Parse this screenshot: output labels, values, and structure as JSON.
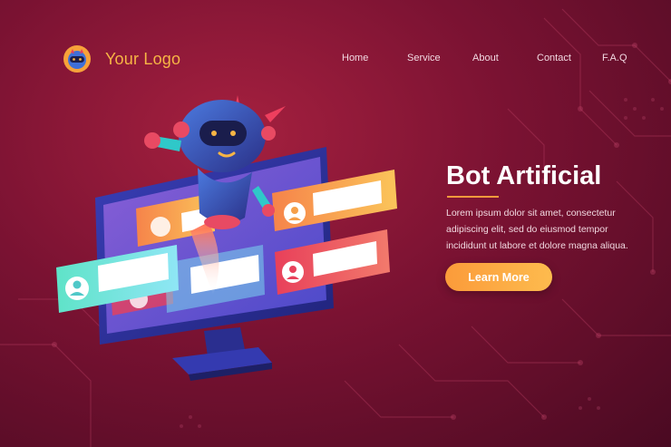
{
  "brand": {
    "logo_text": "Your Logo",
    "logo_icon": "robot-head-icon"
  },
  "nav": {
    "items": [
      {
        "label": "Home"
      },
      {
        "label": "Service"
      },
      {
        "label": "About"
      },
      {
        "label": "Contact"
      },
      {
        "label": "F.A.Q"
      }
    ]
  },
  "hero": {
    "title": "Bot Artificial",
    "body": "Lorem ipsum dolor sit amet, consectetur adipiscing elit, sed do eiusmod tempor incididunt ut labore et dolore magna aliqua.",
    "cta_label": "Learn More"
  },
  "colors": {
    "background": "#7a1232",
    "accent_orange": "#f7b545",
    "accent_underline": "#f39a3c",
    "cta_gradient_start": "#fb9b3a",
    "cta_gradient_end": "#fdbb4e"
  },
  "illustration": {
    "icons": [
      "robot-icon",
      "monitor-icon",
      "user-profile-card-icon",
      "circuit-pattern-icon"
    ]
  }
}
